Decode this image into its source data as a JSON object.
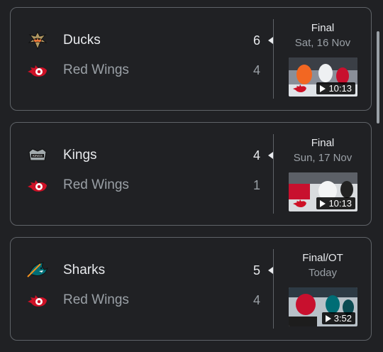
{
  "games": [
    {
      "home": {
        "name": "Ducks",
        "score": "6",
        "logo": "ducks-logo"
      },
      "away": {
        "name": "Red Wings",
        "score": "4",
        "logo": "red-wings-logo"
      },
      "status": "Final",
      "date": "Sat, 16 Nov",
      "video_duration": "10:13"
    },
    {
      "home": {
        "name": "Kings",
        "score": "4",
        "logo": "kings-logo"
      },
      "away": {
        "name": "Red Wings",
        "score": "1",
        "logo": "red-wings-logo"
      },
      "status": "Final",
      "date": "Sun, 17 Nov",
      "video_duration": "10:13"
    },
    {
      "home": {
        "name": "Sharks",
        "score": "5",
        "logo": "sharks-logo"
      },
      "away": {
        "name": "Red Wings",
        "score": "4",
        "logo": "red-wings-logo"
      },
      "status": "Final/OT",
      "date": "Today",
      "video_duration": "3:52"
    }
  ],
  "colors": {
    "background": "#202124",
    "card_border": "#5f6368",
    "text_primary": "#e8eaed",
    "text_secondary": "#9aa0a6",
    "red_wings_red": "#ce1126"
  }
}
